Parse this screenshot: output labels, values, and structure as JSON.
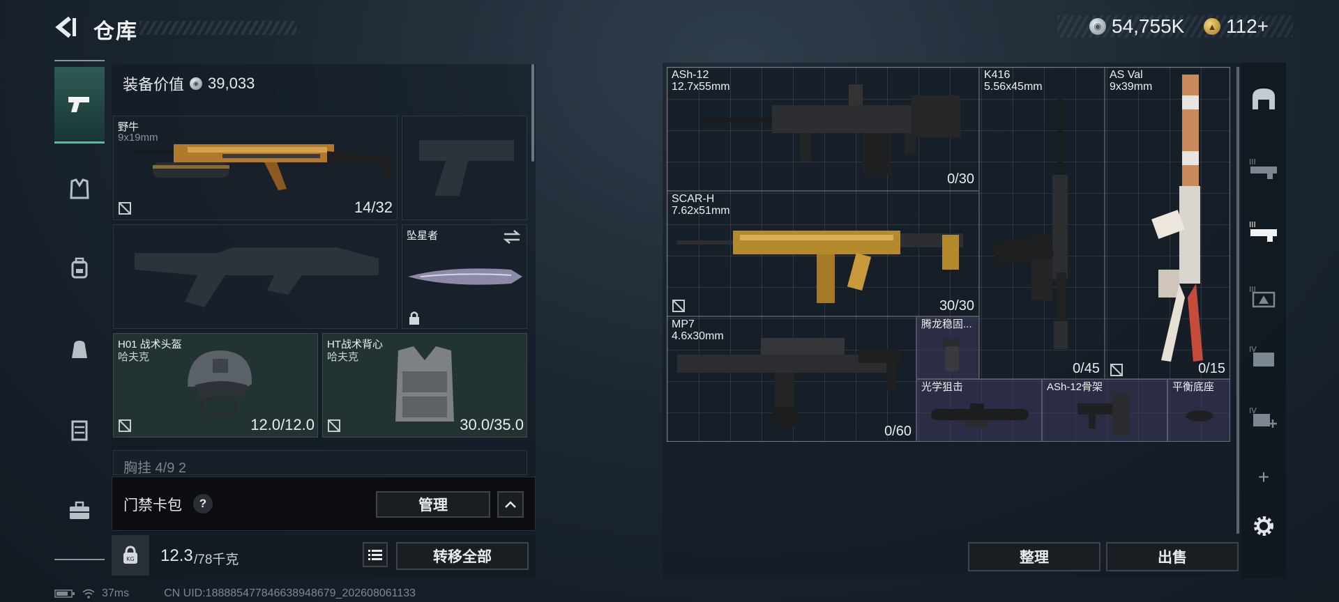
{
  "header": {
    "title": "仓库",
    "silver_amount": "54,755K",
    "gold_amount": "112+"
  },
  "left_tabs": [
    {
      "icon": "pistol-icon",
      "active": true
    },
    {
      "icon": "vest-icon",
      "active": false
    },
    {
      "icon": "backpack-icon",
      "active": false
    },
    {
      "icon": "bag-icon",
      "active": false
    },
    {
      "icon": "locker-icon",
      "active": false
    },
    {
      "icon": "toolbox-icon",
      "active": false
    }
  ],
  "equipment": {
    "value_label": "装备价值",
    "value": "39,033",
    "primary_weapon": {
      "name": "野牛",
      "caliber": "9x19mm",
      "ammo": "14/32"
    },
    "melee": {
      "name": "坠星者"
    },
    "helmet": {
      "name": "H01 战术头盔",
      "brand": "哈夫克",
      "durability": "12.0/12.0"
    },
    "armor": {
      "name": "HT战术背心",
      "brand": "哈夫克",
      "durability": "30.0/35.0"
    },
    "chest_rig_partial": "胸挂  4/9  2"
  },
  "keycard": {
    "label": "门禁卡包",
    "help": "?",
    "manage_label": "管理"
  },
  "weight": {
    "current": "12.3",
    "max": "/78千克",
    "transfer_all_label": "转移全部"
  },
  "stash_items": [
    {
      "name": "ASh-12",
      "caliber": "12.7x55mm",
      "count": "0/30"
    },
    {
      "name": "K416",
      "caliber": "5.56x45mm",
      "count": "0/45"
    },
    {
      "name": "AS Val",
      "caliber": "9x39mm",
      "count": "0/15"
    },
    {
      "name": "SCAR-H",
      "caliber": "7.62x51mm",
      "count": "30/30"
    },
    {
      "name": "MP7",
      "caliber": "4.6x30mm",
      "count": "0/60"
    },
    {
      "name": "腾龙稳固..."
    },
    {
      "name": "光学狙击"
    },
    {
      "name": "ASh-12骨架"
    },
    {
      "name": "平衡底座"
    }
  ],
  "right_tabs": [
    {
      "icon": "safe-box-icon"
    },
    {
      "icon": "stash-page-2-icon",
      "label": "III"
    },
    {
      "icon": "stash-page-3-icon",
      "label": "III",
      "active": true
    },
    {
      "icon": "stash-page-4-icon",
      "label": "III"
    },
    {
      "icon": "stash-page-5-icon",
      "label": "IV"
    },
    {
      "icon": "stash-page-6-icon",
      "label": "IV"
    },
    {
      "icon": "add-page-icon",
      "label": "+"
    },
    {
      "icon": "settings-icon"
    }
  ],
  "actions": {
    "sort_label": "整理",
    "sell_label": "出售"
  },
  "footer": {
    "ping": "37ms",
    "uid": "CN UID:18888547784663894867​9_202608061133"
  }
}
